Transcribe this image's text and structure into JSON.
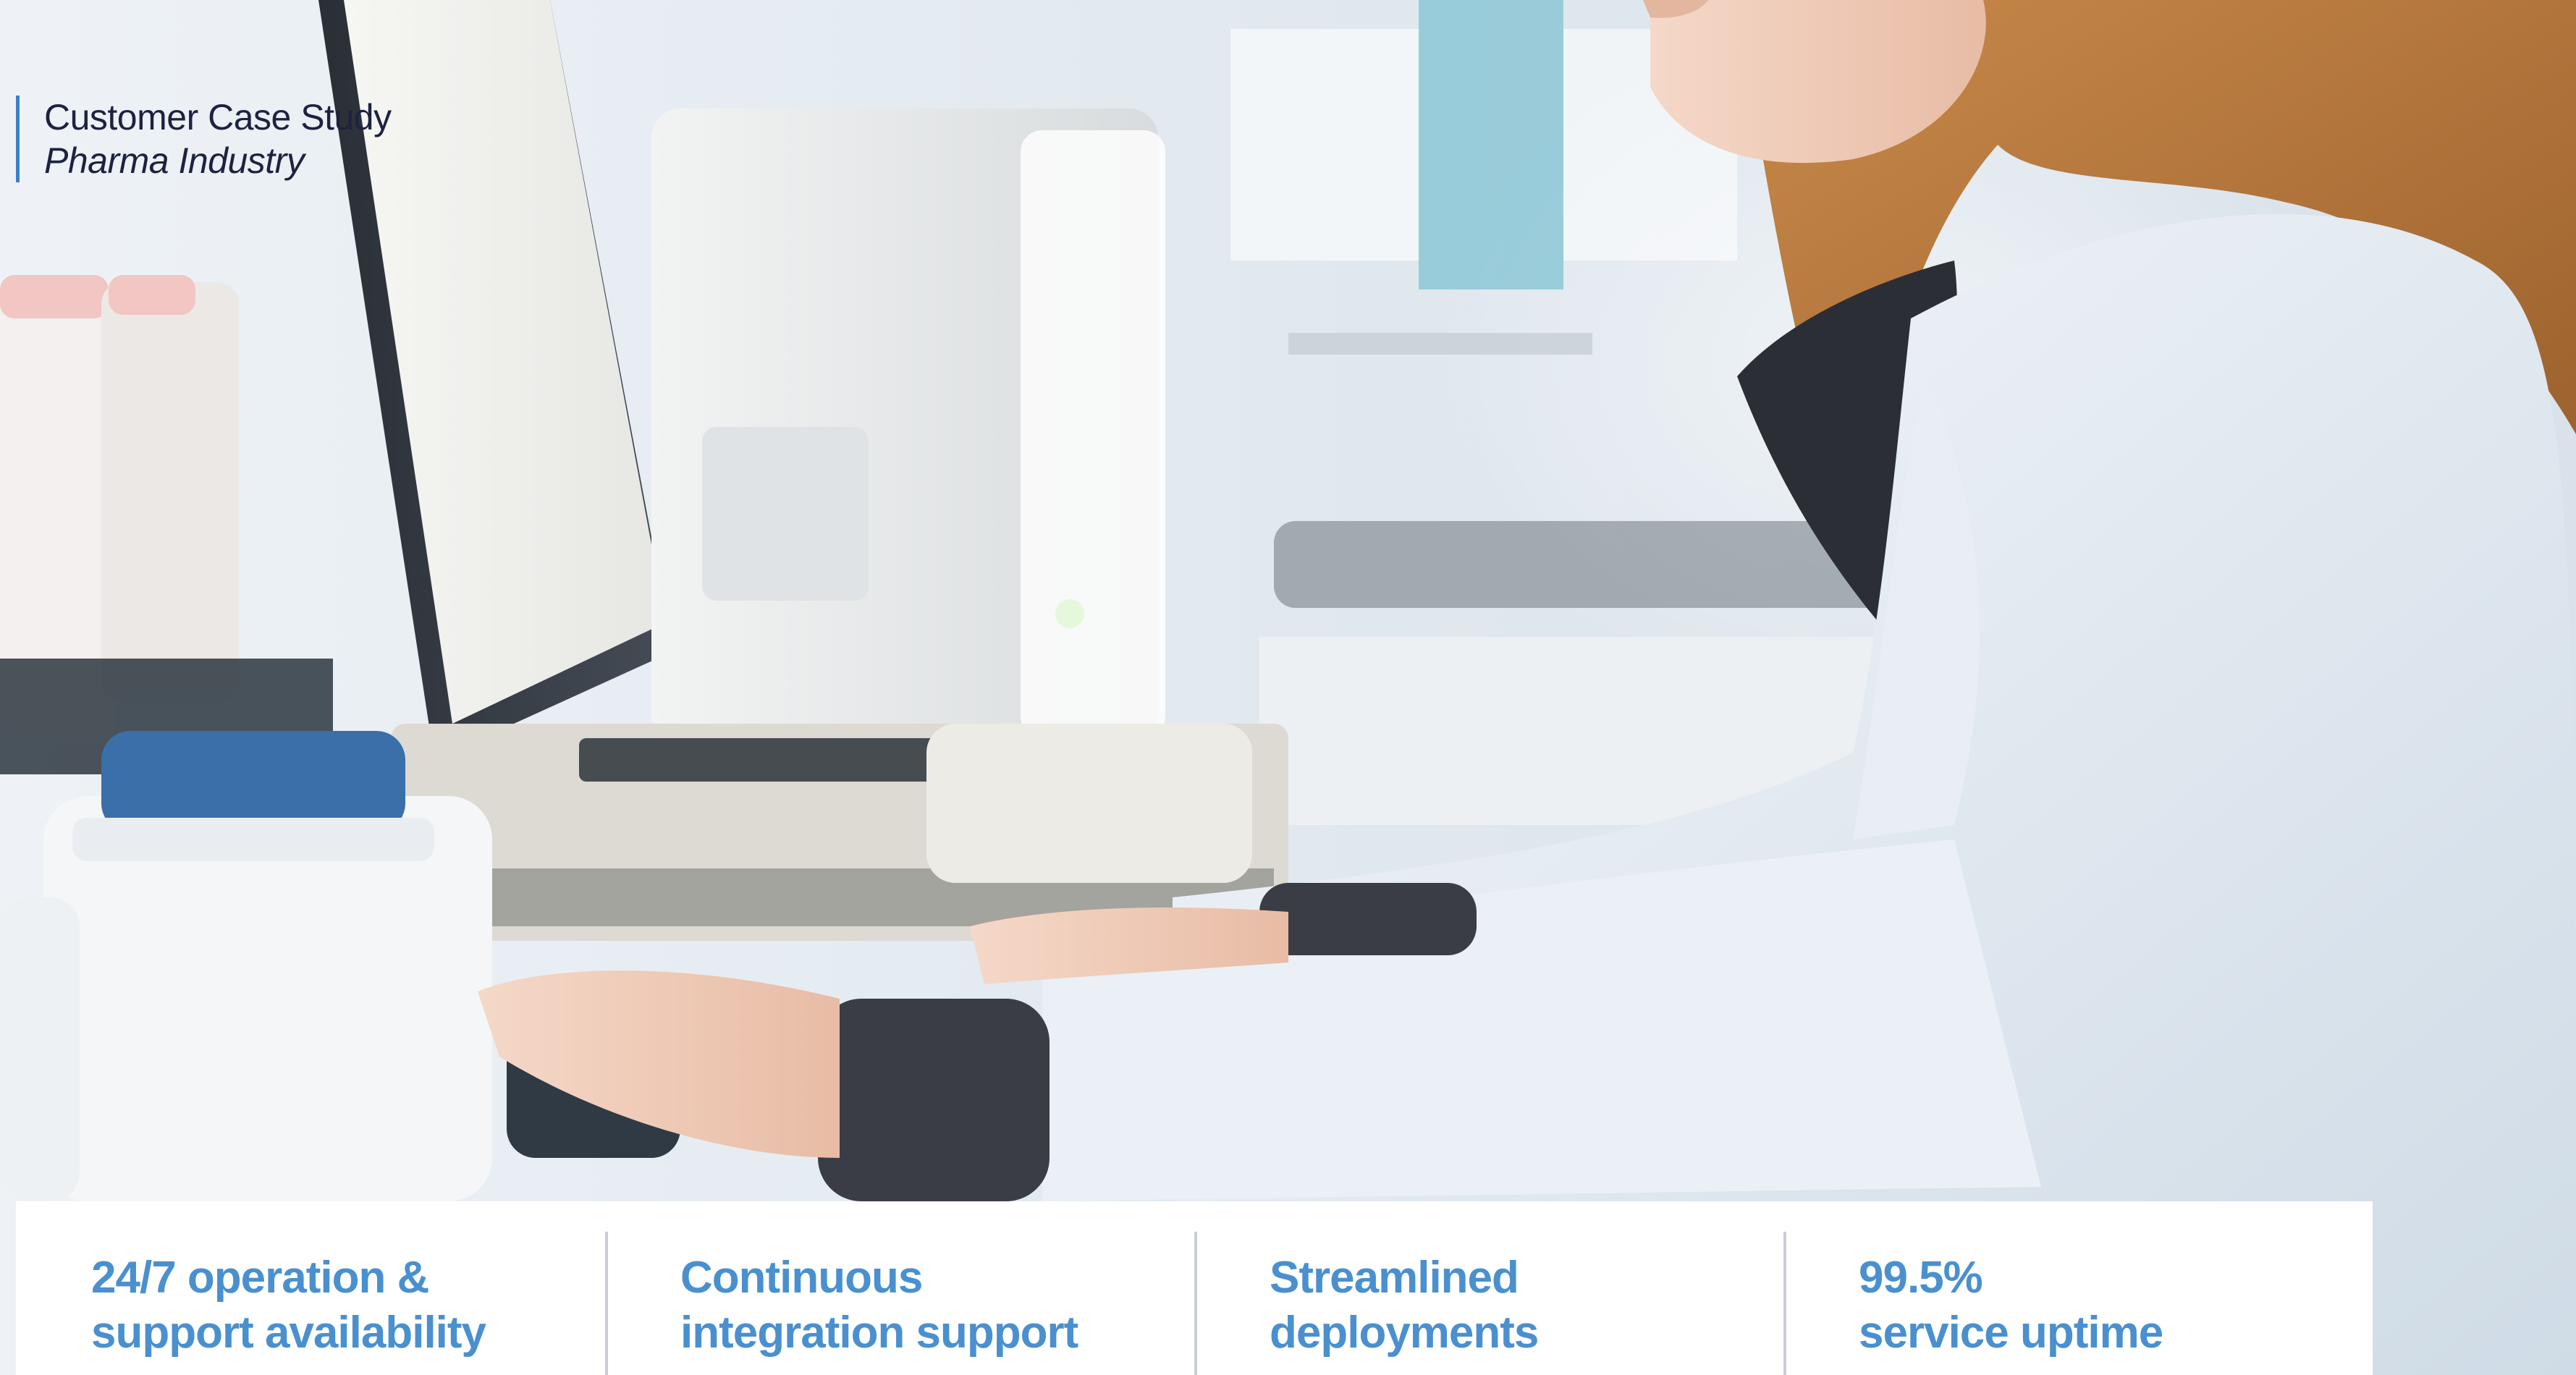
{
  "header": {
    "title": "Customer Case Study",
    "subtitle": "Pharma Industry"
  },
  "stats": [
    {
      "line1": "24/7 operation &",
      "line2": "support availability"
    },
    {
      "line1": "Continuous",
      "line2": "integration support"
    },
    {
      "line1": "Streamlined",
      "line2": "deployments"
    },
    {
      "line1": "99.5%",
      "line2": "service uptime"
    }
  ],
  "colors": {
    "accent": "#3f7fc6",
    "stat_text": "#4a90cf",
    "title_text": "#1d2240",
    "bar_background": "#ffffff"
  }
}
